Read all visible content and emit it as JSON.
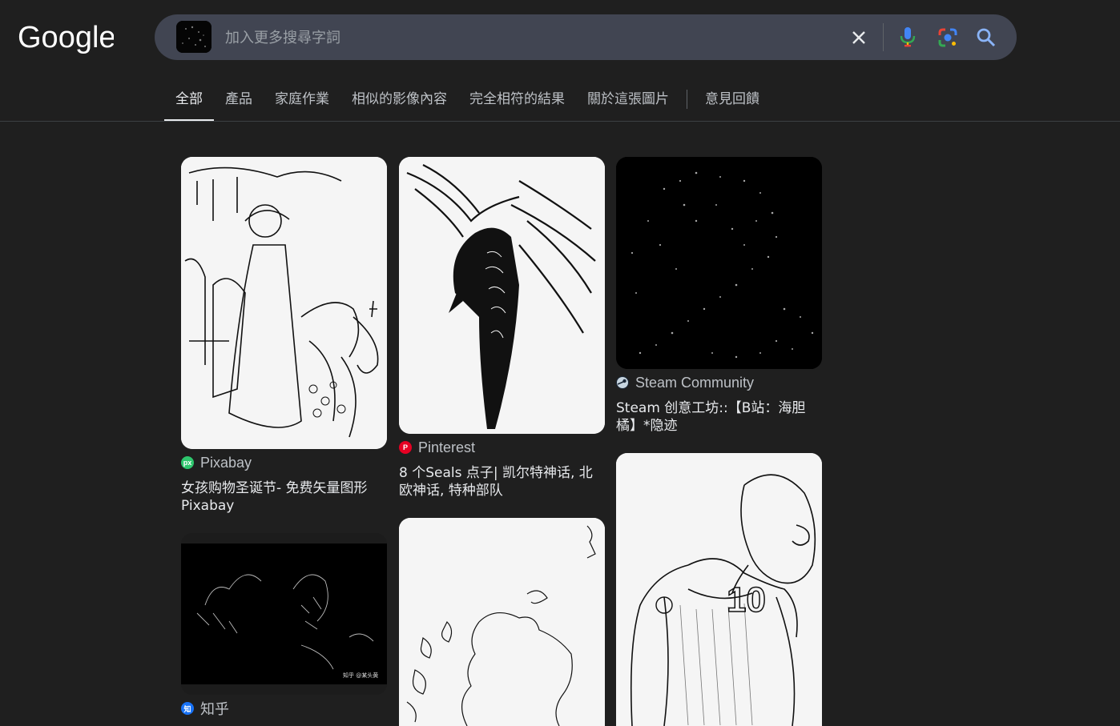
{
  "logo": "Google",
  "search": {
    "placeholder": "加入更多搜尋字詞",
    "value": ""
  },
  "tabs": [
    {
      "label": "全部",
      "active": true
    },
    {
      "label": "產品"
    },
    {
      "label": "家庭作業"
    },
    {
      "label": "相似的影像內容"
    },
    {
      "label": "完全相符的結果"
    },
    {
      "label": "關於這張圖片"
    },
    {
      "label": "意見回饋"
    }
  ],
  "results": [
    {
      "source": "Pixabay",
      "title": "女孩购物圣诞节- 免费矢量图形 Pixabay",
      "favicon_color": "#2ec66d",
      "favicon_text": "px"
    },
    {
      "source": "Pinterest",
      "title": "8 个Seals 点子| 凯尔特神话, 北欧神话, 特种部队",
      "favicon_color": "#e60023",
      "favicon_text": "P"
    },
    {
      "source": "Steam Community",
      "title": "Steam 创意工坊::【B站：海胆橘】*隐迹",
      "favicon_color": "#1b2838",
      "favicon_text": ""
    },
    {
      "source": "知乎",
      "title": "",
      "favicon_color": "#1772f6",
      "favicon_text": "知"
    },
    {
      "source": "",
      "title": ""
    },
    {
      "source": "",
      "title": ""
    }
  ],
  "watermark": "知乎 @某头黄",
  "jersey_number": "10",
  "colors": {
    "background": "#1f1f1f",
    "searchbar": "#414552",
    "accent_blue": "#8ab4f8"
  }
}
